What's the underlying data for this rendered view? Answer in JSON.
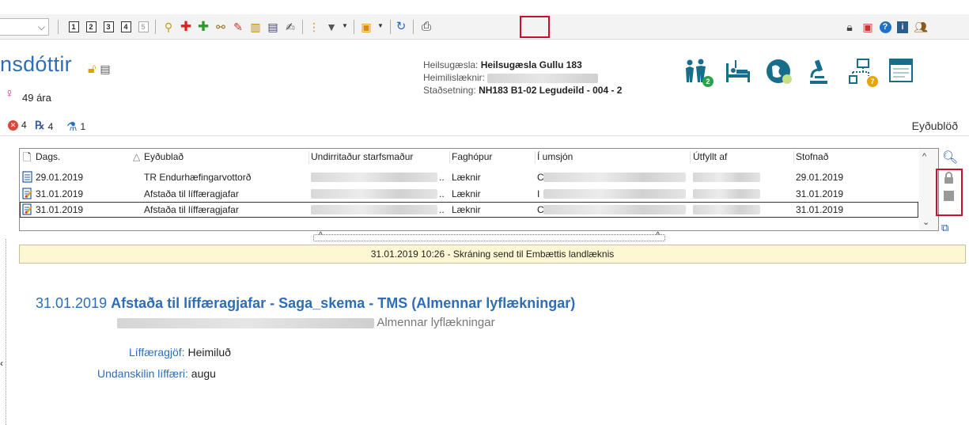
{
  "toolbar": {
    "combo_value": "",
    "buttons": [
      {
        "name": "button-1",
        "label": "1"
      },
      {
        "name": "button-2",
        "label": "2"
      },
      {
        "name": "button-3",
        "label": "3"
      },
      {
        "name": "button-4",
        "label": "4"
      },
      {
        "name": "button-5",
        "label": "5"
      }
    ]
  },
  "patient": {
    "name": "nsdóttir",
    "age": "49 ára"
  },
  "header_info": {
    "clinic_label": "Heilsugæsla:",
    "clinic_value": "Heilsugæsla Gullu 183",
    "gp_label": "Heimilislæknir:",
    "location_label": "Staðsetning:",
    "location_value": "NH183 B1-02 Legudeild - 004 - 2"
  },
  "badges": {
    "people_count": "2",
    "network_count": "7"
  },
  "status": {
    "alerts": "4",
    "prescriptions": "4",
    "flasks": "1"
  },
  "section_label": "Eyðublöð",
  "grid": {
    "headers": {
      "date": "Dags.",
      "form": "Eyðublað",
      "signed_by": "Undirritaður starfsmaður",
      "profession": "Faghópur",
      "in_charge": "Í umsjón",
      "filled_by": "Útfyllt af",
      "created": "Stofnað"
    },
    "rows": [
      {
        "date": "29.01.2019",
        "form": "TR Endurhæfingarvottorð",
        "profession": "Læknir",
        "created": "29.01.2019",
        "in_charge_initial": "C"
      },
      {
        "date": "31.01.2019",
        "form": "Afstaða til líffæragjafar",
        "profession": "Læknir",
        "created": "31.01.2019",
        "in_charge_initial": "I"
      },
      {
        "date": "31.01.2019",
        "form": "Afstaða til líffæragjafar",
        "profession": "Læknir",
        "created": "31.01.2019",
        "in_charge_initial": "C"
      }
    ]
  },
  "banner": "31.01.2019 10:26 - Skráning send til Embættis landlæknis",
  "document": {
    "date": "31.01.2019",
    "title": "Afstaða til líffæragjafar - Saga_skema - TMS (Almennar lyflækningar)",
    "subtitle": "Almennar lyflækningar",
    "fields": [
      {
        "label": "Líffæragjöf:",
        "value": "Heimiluð"
      },
      {
        "label": "Undanskilin líffæri:",
        "value": "augu"
      }
    ]
  },
  "colors": {
    "accent_blue": "#2f6db5",
    "highlight_red": "#c8102e",
    "banner_bg": "#fdf7d3"
  }
}
